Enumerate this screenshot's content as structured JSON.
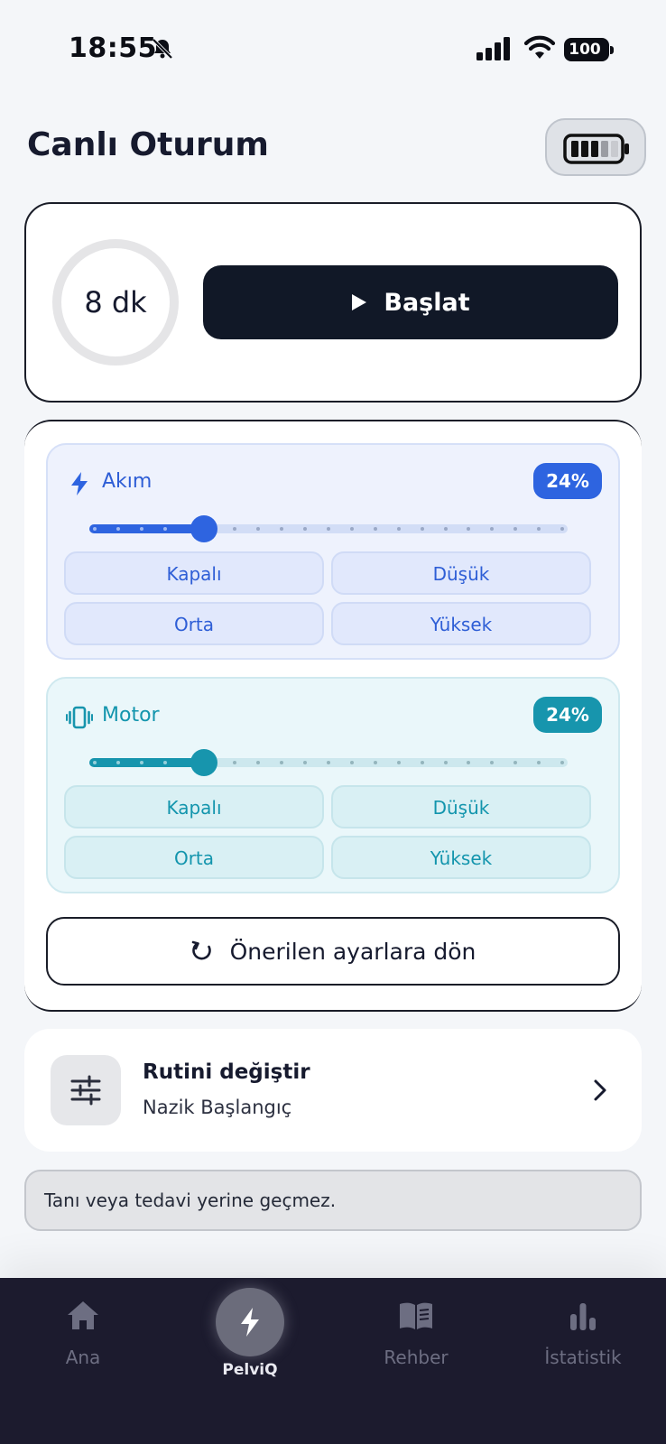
{
  "status_bar": {
    "time": "18:55",
    "battery": "100",
    "icons": [
      "bell-slash-icon",
      "signal-icon",
      "wifi-icon",
      "battery-icon"
    ]
  },
  "header": {
    "title": "Canlı Oturum",
    "battery_button_icon": "battery-icon"
  },
  "session": {
    "duration": "8 dk",
    "start_label": "Başlat",
    "start_icon": "play-icon"
  },
  "akim": {
    "title": "Akım",
    "icon": "bolt-icon",
    "percent": "24%",
    "level": 0.24,
    "modes": [
      "Kapalı",
      "Düşük",
      "Orta",
      "Yüksek"
    ]
  },
  "motor": {
    "title": "Motor",
    "icon": "vibration-icon",
    "percent": "24%",
    "level": 0.24,
    "modes": [
      "Kapalı",
      "Düşük",
      "Orta",
      "Yüksek"
    ]
  },
  "reset": {
    "label": "Önerilen ayarlara dön",
    "icon": "refresh-icon"
  },
  "routine": {
    "title": "Rutini değiştir",
    "subtitle": "Nazik Başlangıç",
    "icon": "sliders-icon"
  },
  "disclaimer": "Tanı veya tedavi yerine geçmez.",
  "nav": {
    "items": [
      {
        "label": "Ana",
        "icon": "home-icon"
      },
      {
        "label": "PelviQ",
        "icon": "bolt-icon"
      },
      {
        "label": "Rehber",
        "icon": "book-icon"
      },
      {
        "label": "İstatistik",
        "icon": "bar-chart-icon"
      }
    ],
    "active": "PelviQ"
  },
  "colors": {
    "akim_accent": "#2e64e0",
    "motor_accent": "#1795ad",
    "primary_button": "#111827",
    "nav_background": "#1c1b2e"
  }
}
